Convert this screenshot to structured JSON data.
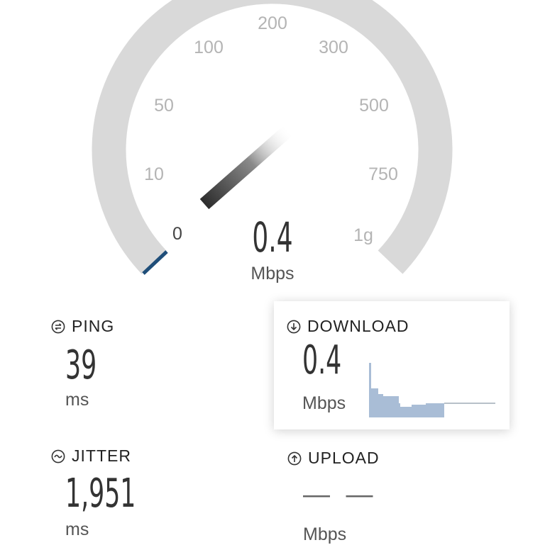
{
  "gauge": {
    "tick_labels": [
      "0",
      "10",
      "50",
      "100",
      "200",
      "300",
      "500",
      "750",
      "1g"
    ],
    "current_value": "0.4",
    "current_unit": "Mbps",
    "needle_value": 0.4,
    "colors": {
      "track": "#d9d9d9",
      "progress": "#1f4e79",
      "needle_dark": "#333333"
    }
  },
  "ping": {
    "label": "PING",
    "value": "39",
    "unit": "ms"
  },
  "jitter": {
    "label": "JITTER",
    "value": "1,951",
    "unit": "ms"
  },
  "download": {
    "label": "DOWNLOAD",
    "value": "0.4",
    "unit": "Mbps",
    "sparkline_color": "#a9bdd6"
  },
  "upload": {
    "label": "UPLOAD",
    "value": "— —",
    "unit": "Mbps"
  }
}
